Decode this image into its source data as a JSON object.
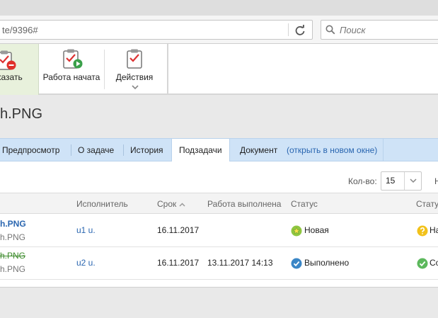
{
  "browser": {
    "url": "te/9396#",
    "search_placeholder": "Поиск"
  },
  "toolbar": {
    "show_label": "казать",
    "start_label": "Работа начата",
    "actions_label": "Действия"
  },
  "page": {
    "title": "h.PNG"
  },
  "tabs": {
    "items": [
      {
        "label": "Предпросмотр"
      },
      {
        "label": "О задаче"
      },
      {
        "label": "История"
      },
      {
        "label": "Подзадачи"
      },
      {
        "label": "Документ"
      }
    ],
    "open_link": "(открыть в новом окне)"
  },
  "pager": {
    "count_label": "Кол-во:",
    "count_value": "15",
    "edge_text": "Н"
  },
  "table": {
    "headers": {
      "executor": "Исполнитель",
      "deadline": "Срок",
      "done": "Работа выполнена",
      "status": "Статус",
      "status2": "Стату"
    },
    "rows": [
      {
        "name": "h.PNG",
        "sub": "h.PNG",
        "executor": "u1 u.",
        "deadline": "16.11.2017",
        "done": "",
        "status": "Новая",
        "status2": "На"
      },
      {
        "name": "h.PNG",
        "sub": "h.PNG",
        "executor": "u2 u.",
        "deadline": "16.11.2017",
        "done": "13.11.2017 14:13",
        "status": "Выполнено",
        "status2": "Со"
      }
    ]
  },
  "colors": {
    "accent_blue": "#2a66b0",
    "tab_bar": "#cfe3f7",
    "status_new": "#8fc640",
    "status_done": "#3a86c6",
    "status2_pending": "#f2c21b",
    "status2_ok": "#5cb85c"
  },
  "icons": [
    "reload-icon",
    "search-icon",
    "clipboard-remove-icon",
    "clipboard-play-icon",
    "clipboard-check-icon",
    "chevron-down-icon",
    "sort-asc-icon",
    "star-icon",
    "check-icon",
    "question-icon"
  ]
}
